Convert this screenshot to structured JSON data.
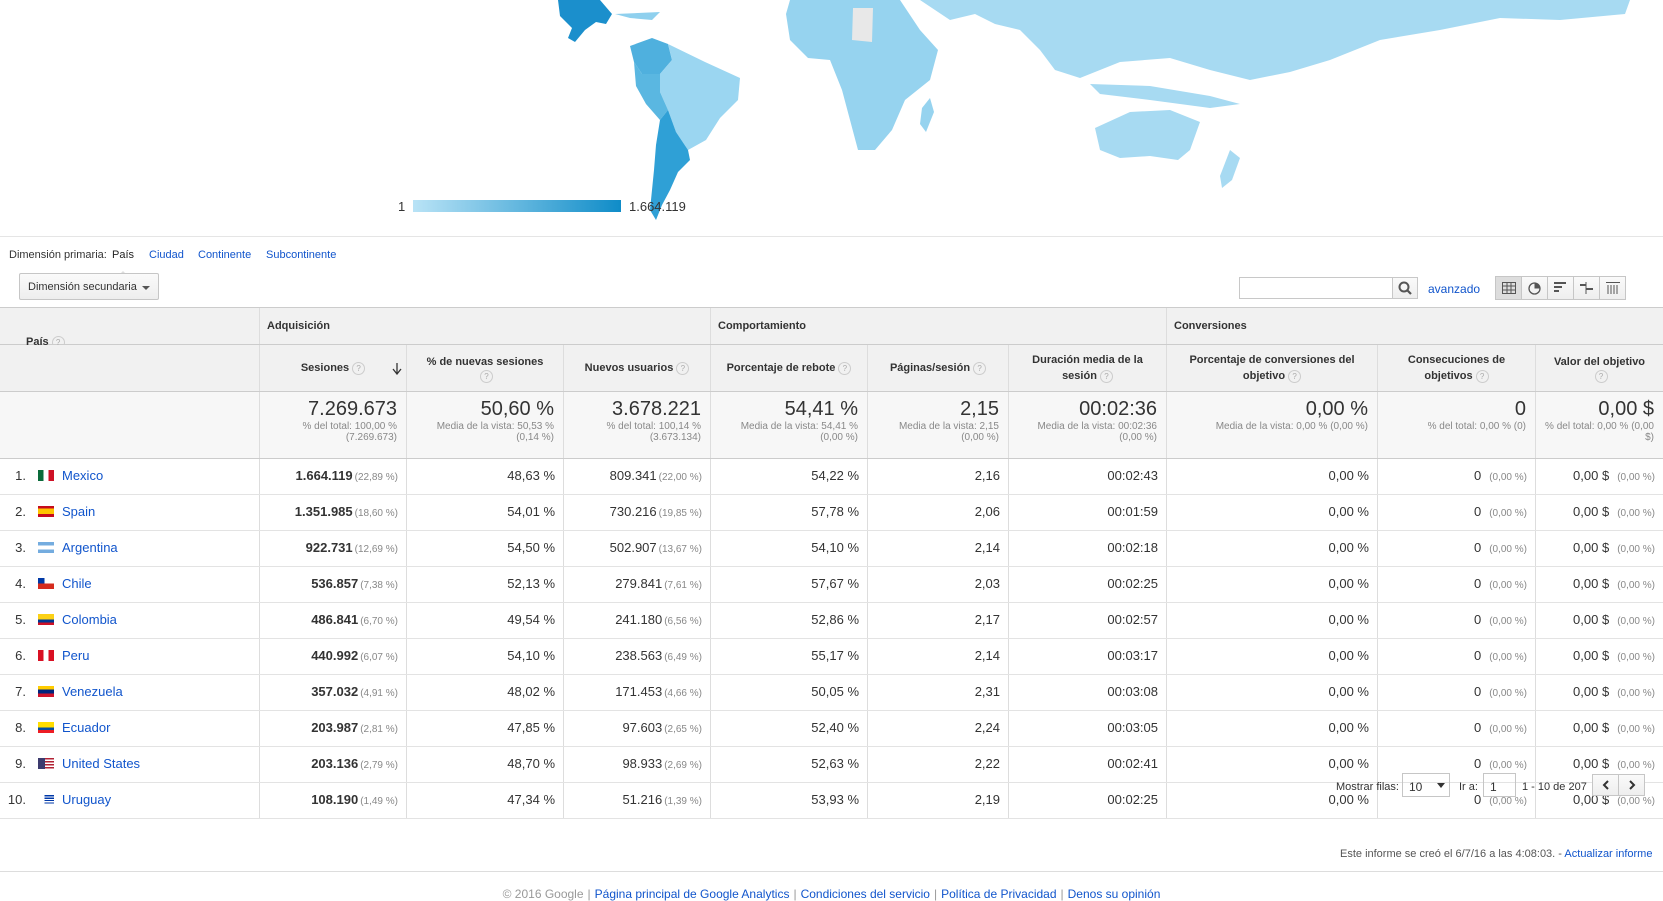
{
  "map": {
    "legend_min": "1",
    "legend_max": "1.664.119",
    "colors": {
      "low": "#b9e3f6",
      "high": "#0f8cc8"
    }
  },
  "primary_dimension": {
    "label": "Dimensión primaria:",
    "options": [
      "País",
      "Ciudad",
      "Continente",
      "Subcontinente"
    ],
    "selected": "País"
  },
  "toolbar": {
    "secondary_dimension": "Dimensión secundaria",
    "search_value": "",
    "advanced": "avanzado",
    "view_icons": [
      "table-view-icon",
      "pie-view-icon",
      "performance-view-icon",
      "comparison-view-icon",
      "pivot-view-icon"
    ]
  },
  "table": {
    "dimension_header": "País",
    "groups": [
      "Adquisición",
      "Comportamiento",
      "Conversiones"
    ],
    "columns": [
      "Sesiones",
      "% de nuevas sesiones",
      "Nuevos usuarios",
      "Porcentaje de rebote",
      "Páginas/sesión",
      "Duración media de la sesión",
      "Porcentaje de conversiones del objetivo",
      "Consecuciones de objetivos",
      "Valor del objetivo"
    ],
    "totals": [
      {
        "value": "7.269.673",
        "sub": "% del total: 100,00 % (7.269.673)"
      },
      {
        "value": "50,60 %",
        "sub": "Media de la vista: 50,53 % (0,14 %)"
      },
      {
        "value": "3.678.221",
        "sub": "% del total: 100,14 % (3.673.134)"
      },
      {
        "value": "54,41 %",
        "sub": "Media de la vista: 54,41 % (0,00 %)"
      },
      {
        "value": "2,15",
        "sub": "Media de la vista: 2,15 (0,00 %)"
      },
      {
        "value": "00:02:36",
        "sub": "Media de la vista: 00:02:36 (0,00 %)"
      },
      {
        "value": "0,00 %",
        "sub": "Media de la vista: 0,00 % (0,00 %)"
      },
      {
        "value": "0",
        "sub": "% del total: 0,00 % (0)"
      },
      {
        "value": "0,00 $",
        "sub": "% del total: 0,00 % (0,00 $)"
      }
    ],
    "rows": [
      {
        "n": "1.",
        "country": "Mexico",
        "flag": "mx",
        "sessions": "1.664.119",
        "sessions_pct": "(22,89 %)",
        "new_pct": "48,63 %",
        "new_users": "809.341",
        "new_users_pct": "(22,00 %)",
        "bounce": "54,22 %",
        "pages": "2,16",
        "duration": "00:02:43",
        "conv": "0,00 %",
        "goals": "0",
        "goals_pct": "(0,00 %)",
        "value": "0,00 $",
        "value_pct": "(0,00 %)"
      },
      {
        "n": "2.",
        "country": "Spain",
        "flag": "es",
        "sessions": "1.351.985",
        "sessions_pct": "(18,60 %)",
        "new_pct": "54,01 %",
        "new_users": "730.216",
        "new_users_pct": "(19,85 %)",
        "bounce": "57,78 %",
        "pages": "2,06",
        "duration": "00:01:59",
        "conv": "0,00 %",
        "goals": "0",
        "goals_pct": "(0,00 %)",
        "value": "0,00 $",
        "value_pct": "(0,00 %)"
      },
      {
        "n": "3.",
        "country": "Argentina",
        "flag": "ar",
        "sessions": "922.731",
        "sessions_pct": "(12,69 %)",
        "new_pct": "54,50 %",
        "new_users": "502.907",
        "new_users_pct": "(13,67 %)",
        "bounce": "54,10 %",
        "pages": "2,14",
        "duration": "00:02:18",
        "conv": "0,00 %",
        "goals": "0",
        "goals_pct": "(0,00 %)",
        "value": "0,00 $",
        "value_pct": "(0,00 %)"
      },
      {
        "n": "4.",
        "country": "Chile",
        "flag": "cl",
        "sessions": "536.857",
        "sessions_pct": "(7,38 %)",
        "new_pct": "52,13 %",
        "new_users": "279.841",
        "new_users_pct": "(7,61 %)",
        "bounce": "57,67 %",
        "pages": "2,03",
        "duration": "00:02:25",
        "conv": "0,00 %",
        "goals": "0",
        "goals_pct": "(0,00 %)",
        "value": "0,00 $",
        "value_pct": "(0,00 %)"
      },
      {
        "n": "5.",
        "country": "Colombia",
        "flag": "co",
        "sessions": "486.841",
        "sessions_pct": "(6,70 %)",
        "new_pct": "49,54 %",
        "new_users": "241.180",
        "new_users_pct": "(6,56 %)",
        "bounce": "52,86 %",
        "pages": "2,17",
        "duration": "00:02:57",
        "conv": "0,00 %",
        "goals": "0",
        "goals_pct": "(0,00 %)",
        "value": "0,00 $",
        "value_pct": "(0,00 %)"
      },
      {
        "n": "6.",
        "country": "Peru",
        "flag": "pe",
        "sessions": "440.992",
        "sessions_pct": "(6,07 %)",
        "new_pct": "54,10 %",
        "new_users": "238.563",
        "new_users_pct": "(6,49 %)",
        "bounce": "55,17 %",
        "pages": "2,14",
        "duration": "00:03:17",
        "conv": "0,00 %",
        "goals": "0",
        "goals_pct": "(0,00 %)",
        "value": "0,00 $",
        "value_pct": "(0,00 %)"
      },
      {
        "n": "7.",
        "country": "Venezuela",
        "flag": "ve",
        "sessions": "357.032",
        "sessions_pct": "(4,91 %)",
        "new_pct": "48,02 %",
        "new_users": "171.453",
        "new_users_pct": "(4,66 %)",
        "bounce": "50,05 %",
        "pages": "2,31",
        "duration": "00:03:08",
        "conv": "0,00 %",
        "goals": "0",
        "goals_pct": "(0,00 %)",
        "value": "0,00 $",
        "value_pct": "(0,00 %)"
      },
      {
        "n": "8.",
        "country": "Ecuador",
        "flag": "ec",
        "sessions": "203.987",
        "sessions_pct": "(2,81 %)",
        "new_pct": "47,85 %",
        "new_users": "97.603",
        "new_users_pct": "(2,65 %)",
        "bounce": "52,40 %",
        "pages": "2,24",
        "duration": "00:03:05",
        "conv": "0,00 %",
        "goals": "0",
        "goals_pct": "(0,00 %)",
        "value": "0,00 $",
        "value_pct": "(0,00 %)"
      },
      {
        "n": "9.",
        "country": "United States",
        "flag": "us",
        "sessions": "203.136",
        "sessions_pct": "(2,79 %)",
        "new_pct": "48,70 %",
        "new_users": "98.933",
        "new_users_pct": "(2,69 %)",
        "bounce": "52,63 %",
        "pages": "2,22",
        "duration": "00:02:41",
        "conv": "0,00 %",
        "goals": "0",
        "goals_pct": "(0,00 %)",
        "value": "0,00 $",
        "value_pct": "(0,00 %)"
      },
      {
        "n": "10.",
        "country": "Uruguay",
        "flag": "uy",
        "sessions": "108.190",
        "sessions_pct": "(1,49 %)",
        "new_pct": "47,34 %",
        "new_users": "51.216",
        "new_users_pct": "(1,39 %)",
        "bounce": "53,93 %",
        "pages": "2,19",
        "duration": "00:02:25",
        "conv": "0,00 %",
        "goals": "0",
        "goals_pct": "(0,00 %)",
        "value": "0,00 $",
        "value_pct": "(0,00 %)"
      }
    ]
  },
  "pager": {
    "rows_label": "Mostrar filas:",
    "rows_value": "10",
    "goto_label": "Ir a:",
    "goto_value": "1",
    "range": "1 - 10 de 207"
  },
  "created": {
    "text": "Este informe se creó el 6/7/16 a las 4:08:03. -",
    "link": "Actualizar informe"
  },
  "footer": {
    "copyright": "© 2016 Google",
    "links": [
      "Página principal de Google Analytics",
      "Condiciones del servicio",
      "Política de Privacidad",
      "Denos su opinión"
    ]
  }
}
